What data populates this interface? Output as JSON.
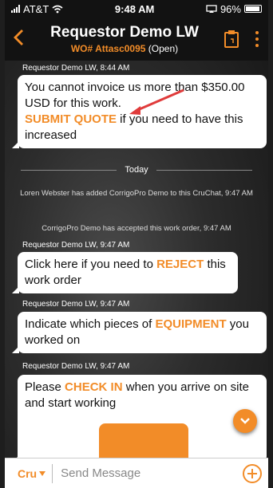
{
  "status_bar": {
    "carrier": "AT&T",
    "time": "9:48 AM",
    "battery": "96%"
  },
  "header": {
    "back_icon": "chevron-left-icon",
    "title": "Requestor Demo LW",
    "wo_number": "WO# Attasc0095",
    "wo_status": "(Open)"
  },
  "messages": [
    {
      "meta": "Requestor Demo LW, 8:44 AM",
      "pre": "You cannot invoice us more than $350.00 USD for this work.",
      "highlight": "SUBMIT QUOTE",
      "post": " if you need to have this increased"
    }
  ],
  "divider": {
    "label": "Today"
  },
  "system_messages": [
    "Loren Webster has added CorrigoPro Demo to this CruChat, 9:47 AM",
    "CorrigoPro Demo has accepted this work order, 9:47 AM"
  ],
  "bot_messages": [
    {
      "meta": "Requestor Demo LW, 9:47 AM",
      "pre": "Click here if you need to ",
      "highlight": "REJECT",
      "post": " this work order"
    },
    {
      "meta": "Requestor Demo LW, 9:47 AM",
      "pre": "Indicate which pieces of ",
      "highlight": "EQUIPMENT",
      "post": " you worked on"
    },
    {
      "meta": "Requestor Demo LW, 9:47 AM",
      "pre": "Please ",
      "highlight": "CHECK IN",
      "post": " when you arrive on site and start working"
    }
  ],
  "input": {
    "channel": "Cru",
    "placeholder": "Send Message"
  },
  "colors": {
    "accent": "#f28c28",
    "annotation_arrow": "#e03b3b"
  }
}
